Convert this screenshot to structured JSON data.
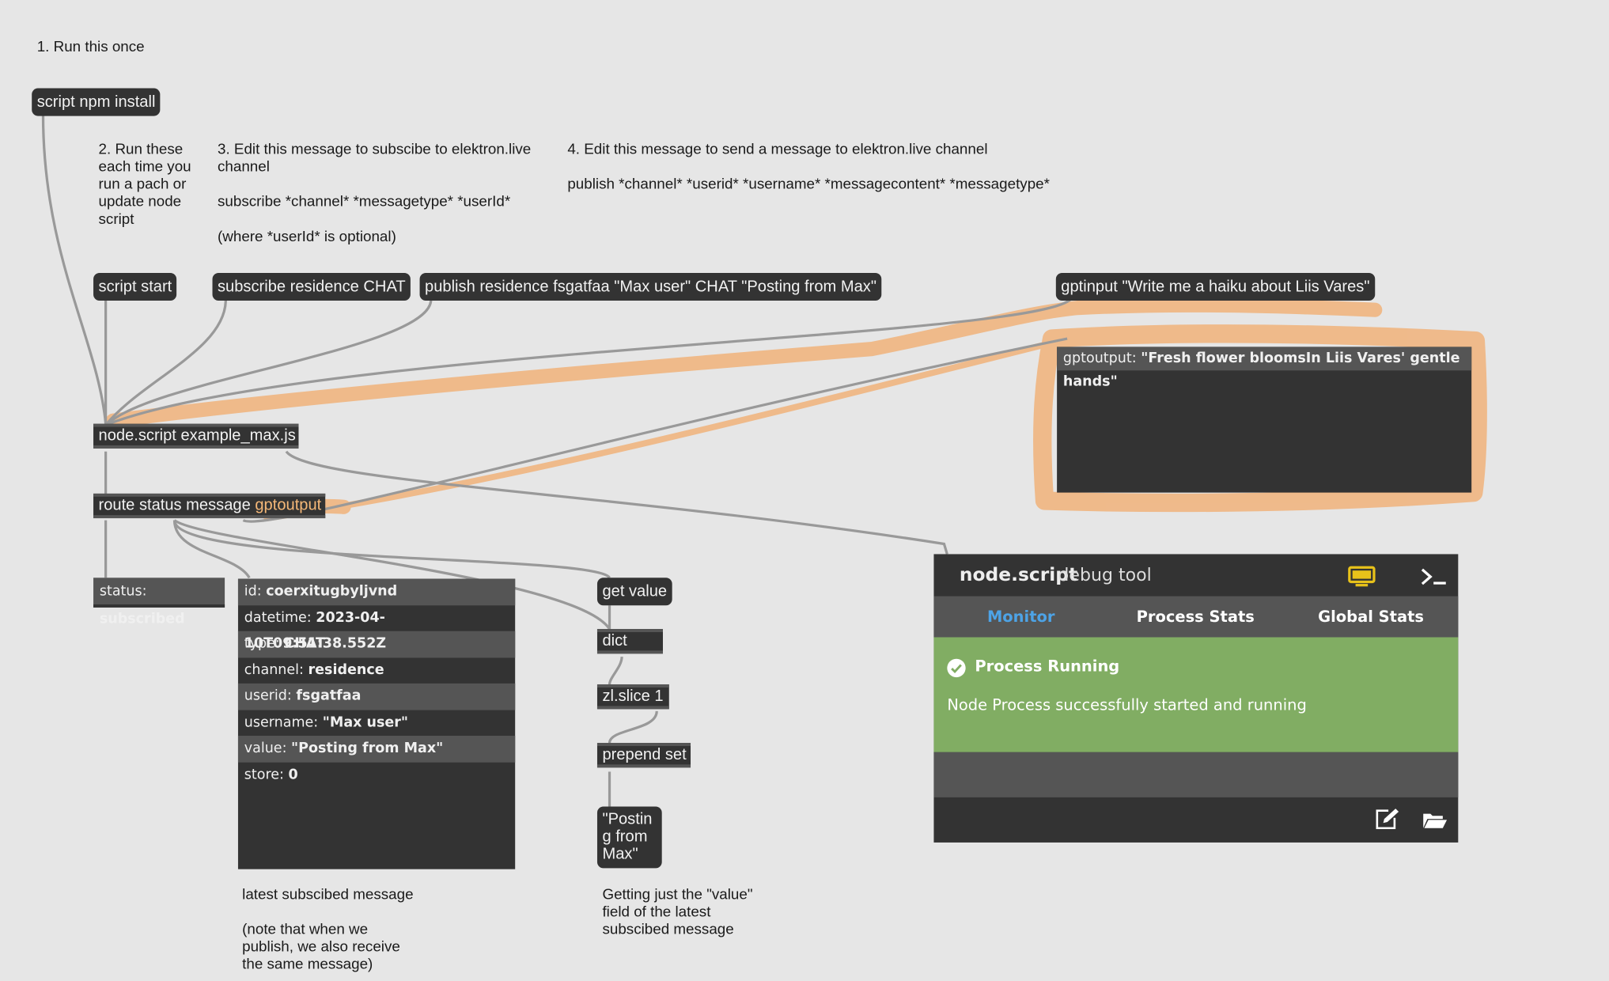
{
  "comments": {
    "step1": "1. Run this once",
    "step2": "2. Run these\neach time you\nrun a pach or\nupdate node\nscript",
    "step3": "3. Edit this message to subscibe to elektron.live\nchannel\n\nsubscribe *channel* *messagetype* *userId*\n\n(where *userId* is optional)",
    "step4": "4. Edit this message to send a message to elektron.live channel\n\npublish *channel* *userid* *username* *messagecontent* *messagetype*",
    "latest": "latest subscibed message\n\n(note that when we\npublish, we also receive\nthe same message)",
    "getting": "Getting just the \"value\"\nfield of the latest\nsubscibed message"
  },
  "messages": {
    "npm_install": "script npm install",
    "script_start": "script start",
    "subscribe": "subscribe residence CHAT",
    "publish": "publish residence fsgatfaa \"Max user\" CHAT \"Posting from Max\"",
    "gptinput": "gptinput \"Write me a haiku about Liis Vares\"",
    "get_value": "get value",
    "value_display": "\"Postin\ng from\nMax\""
  },
  "objects": {
    "node_script": "node.script example_max.js",
    "route_prefix": "route status message",
    "route_orange": "gptoutput",
    "dict": "dict",
    "zl_slice": "zl.slice 1",
    "prepend": "prepend set"
  },
  "status_view": {
    "key": "status:",
    "value": "subscribed"
  },
  "gptoutput_view": {
    "key": "gptoutput:",
    "value": "\"Fresh flower bloomsIn Liis Vares' gentle hands\""
  },
  "dict_view": {
    "rows": [
      {
        "key": "id:",
        "value": "coerxitugbyljvnd"
      },
      {
        "key": "datetime:",
        "value": "2023-04-10T09:51:38.552Z"
      },
      {
        "key": "type:",
        "value": "CHAT"
      },
      {
        "key": "channel:",
        "value": "residence"
      },
      {
        "key": "userid:",
        "value": "fsgatfaa"
      },
      {
        "key": "username:",
        "value": "\"Max user\""
      },
      {
        "key": "value:",
        "value": "\"Posting from Max\""
      },
      {
        "key": "store:",
        "value": "0"
      }
    ]
  },
  "debug_tool": {
    "title_strong": "node.script",
    "title_light": "debug tool",
    "tabs": [
      "Monitor",
      "Process Stats",
      "Global Stats"
    ],
    "active_tab": "Monitor",
    "status_title": "Process Running",
    "status_message": "Node Process successfully started and running",
    "colors": {
      "accent": "#4da3e6",
      "success": "#81ad63",
      "monitor_icon": "#e8c21a"
    },
    "icons": [
      "monitor-icon",
      "terminal-icon",
      "edit-icon",
      "folder-icon",
      "check-circle-icon"
    ]
  },
  "annotation_color": "#f0b27a"
}
